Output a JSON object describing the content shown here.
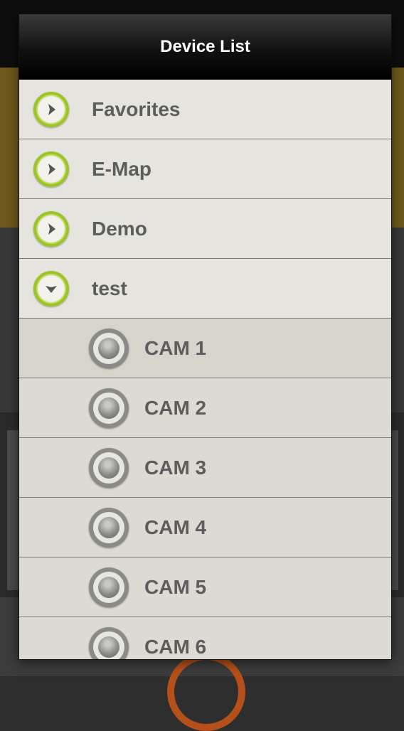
{
  "dialog": {
    "title": "Device List"
  },
  "groups": [
    {
      "label": "Favorites",
      "state": "collapsed",
      "icon": "chevron-right-icon"
    },
    {
      "label": "E-Map",
      "state": "collapsed",
      "icon": "chevron-right-icon"
    },
    {
      "label": "Demo",
      "state": "collapsed",
      "icon": "chevron-right-icon"
    },
    {
      "label": "test",
      "state": "expanded",
      "icon": "chevron-down-icon"
    }
  ],
  "cameras": [
    {
      "label": "CAM 1",
      "icon": "camera-icon"
    },
    {
      "label": "CAM 2",
      "icon": "camera-icon"
    },
    {
      "label": "CAM 3",
      "icon": "camera-icon"
    },
    {
      "label": "CAM 4",
      "icon": "camera-icon"
    },
    {
      "label": "CAM 5",
      "icon": "camera-icon"
    },
    {
      "label": "CAM 6",
      "icon": "camera-icon"
    }
  ],
  "colors": {
    "header": "#000000",
    "title_text": "#ffffff",
    "list_background": "#dedcd5",
    "group_icon_ring": "#9cc42a",
    "label_text": "#5d5d5d"
  }
}
